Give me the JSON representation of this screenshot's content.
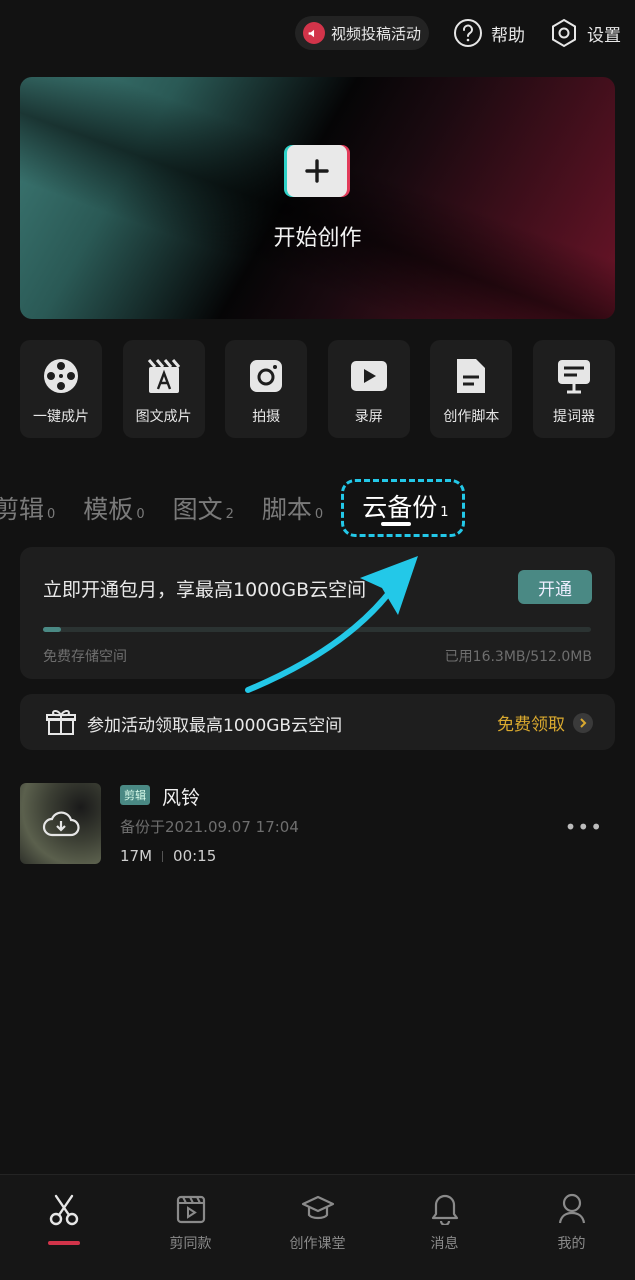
{
  "topbar": {
    "promo_label": "视频投稿活动",
    "help_label": "帮助",
    "settings_label": "设置"
  },
  "hero": {
    "label": "开始创作"
  },
  "tools": [
    {
      "label": "一键成片",
      "icon": "film-reel-icon"
    },
    {
      "label": "图文成片",
      "icon": "text-clapper-icon"
    },
    {
      "label": "拍摄",
      "icon": "camera-icon"
    },
    {
      "label": "录屏",
      "icon": "video-camera-icon"
    },
    {
      "label": "创作脚本",
      "icon": "script-doc-icon"
    },
    {
      "label": "提词器",
      "icon": "teleprompter-icon"
    }
  ],
  "tabs": [
    {
      "label": "剪辑",
      "count": "0"
    },
    {
      "label": "模板",
      "count": "0"
    },
    {
      "label": "图文",
      "count": "2"
    },
    {
      "label": "脚本",
      "count": "0"
    },
    {
      "label": "云备份",
      "count": "1"
    }
  ],
  "cloud": {
    "title": "立即开通包月，享最高1000GB云空间",
    "button": "开通",
    "free_label": "免费存储空间",
    "used_label": "已用16.3MB/512.0MB",
    "used_fraction": 0.032
  },
  "event": {
    "text": "参加活动领取最高1000GB云空间",
    "claim": "免费领取"
  },
  "item": {
    "badge": "剪辑",
    "name": "风铃",
    "date": "备份于2021.09.07 17:04",
    "size": "17M",
    "duration": "00:15",
    "more": "•••"
  },
  "bottom_nav": [
    {
      "label": "",
      "icon": "scissors-icon",
      "active": true
    },
    {
      "label": "剪同款",
      "icon": "template-play-icon"
    },
    {
      "label": "创作课堂",
      "icon": "graduation-cap-icon"
    },
    {
      "label": "消息",
      "icon": "bell-icon"
    },
    {
      "label": "我的",
      "icon": "user-icon"
    }
  ],
  "colors": {
    "accent_teal": "#4a8984",
    "accent_red": "#d2344a",
    "gold": "#d9a92f",
    "annotation_cyan": "#23c8e8"
  }
}
